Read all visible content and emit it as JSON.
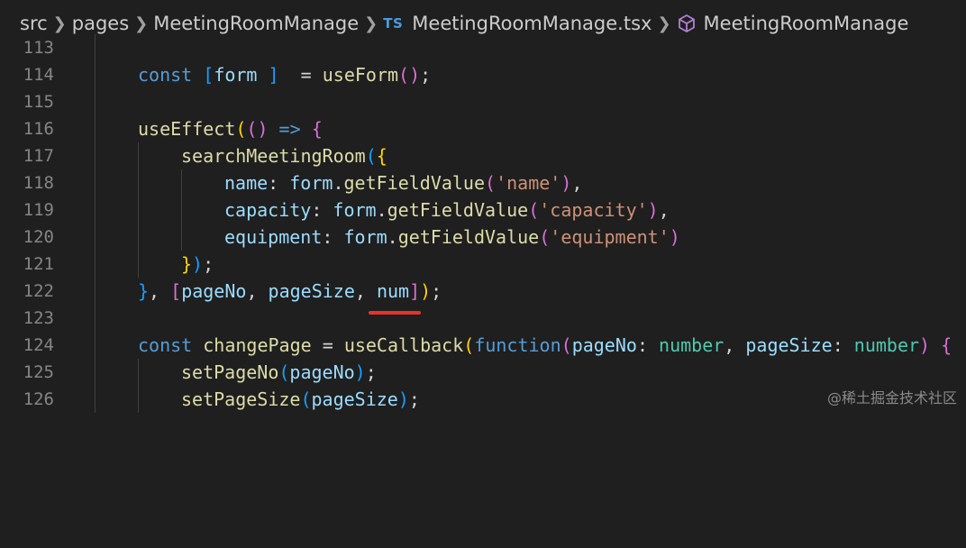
{
  "breadcrumb": {
    "src": "src",
    "pages": "pages",
    "folder": "MeetingRoomManage",
    "file_badge": "TS",
    "file": "MeetingRoomManage.tsx",
    "symbol": "MeetingRoomManage"
  },
  "lines": {
    "l113": {
      "num": "113"
    },
    "l114": {
      "num": "114",
      "t1": "const",
      "t2": " ",
      "t3": "[",
      "t4": "form",
      "t5": " ",
      "t6": "]",
      "t7": "  = ",
      "t8": "useForm",
      "t9": "()",
      "t10": ";"
    },
    "l115": {
      "num": "115"
    },
    "l116": {
      "num": "116",
      "t1": "useEffect",
      "t2": "(",
      "t3": "()",
      "t4": " => ",
      "t5": "{"
    },
    "l117": {
      "num": "117",
      "t1": "searchMeetingRoom",
      "t2": "(",
      "t3": "{"
    },
    "l118": {
      "num": "118",
      "t1": "name",
      "t2": ": ",
      "t3": "form",
      "t4": ".",
      "t5": "getFieldValue",
      "t6": "(",
      "t7": "'name'",
      "t8": ")",
      "t9": ","
    },
    "l119": {
      "num": "119",
      "t1": "capacity",
      "t2": ": ",
      "t3": "form",
      "t4": ".",
      "t5": "getFieldValue",
      "t6": "(",
      "t7": "'capacity'",
      "t8": ")",
      "t9": ","
    },
    "l120": {
      "num": "120",
      "t1": "equipment",
      "t2": ": ",
      "t3": "form",
      "t4": ".",
      "t5": "getFieldValue",
      "t6": "(",
      "t7": "'equipment'",
      "t8": ")"
    },
    "l121": {
      "num": "121",
      "t1": "}",
      "t2": ")",
      "t3": ";"
    },
    "l122": {
      "num": "122",
      "t1": "}",
      "t2": ", ",
      "t3": "[",
      "t4": "pageNo",
      "t5": ", ",
      "t6": "pageSize",
      "t7": ", ",
      "t8": "num",
      "t9": "]",
      "t10": ")",
      "t11": ";"
    },
    "l123": {
      "num": "123"
    },
    "l124": {
      "num": "124",
      "t1": "const",
      "t2": " ",
      "t3": "changePage",
      "t4": " = ",
      "t5": "useCallback",
      "t6": "(",
      "t7": "function",
      "t8": "(",
      "t9": "pageNo",
      "t10": ": ",
      "t11": "number",
      "t12": ", ",
      "t13": "pageSize",
      "t14": ": ",
      "t15": "number",
      "t16": ")",
      "t17": " ",
      "t18": "{"
    },
    "l125": {
      "num": "125",
      "t1": "setPageNo",
      "t2": "(",
      "t3": "pageNo",
      "t4": ")",
      "t5": ";"
    },
    "l126": {
      "num": "126",
      "t1": "setPageSize",
      "t2": "(",
      "t3": "pageSize",
      "t4": ")",
      "t5": ";"
    }
  },
  "watermark": "@稀土掘金技术社区",
  "colors": {
    "background": "#1f1f1f",
    "keyword": "#569cd6",
    "function": "#dcdcaa",
    "variable": "#9cdcfe",
    "string": "#ce9178",
    "type": "#4ec9b0",
    "highlight_underline": "#e8332a"
  },
  "icons": {
    "breadcrumb_separator": "chevron-right-icon",
    "file_type": "typescript-file-icon",
    "symbol": "cube-icon"
  }
}
